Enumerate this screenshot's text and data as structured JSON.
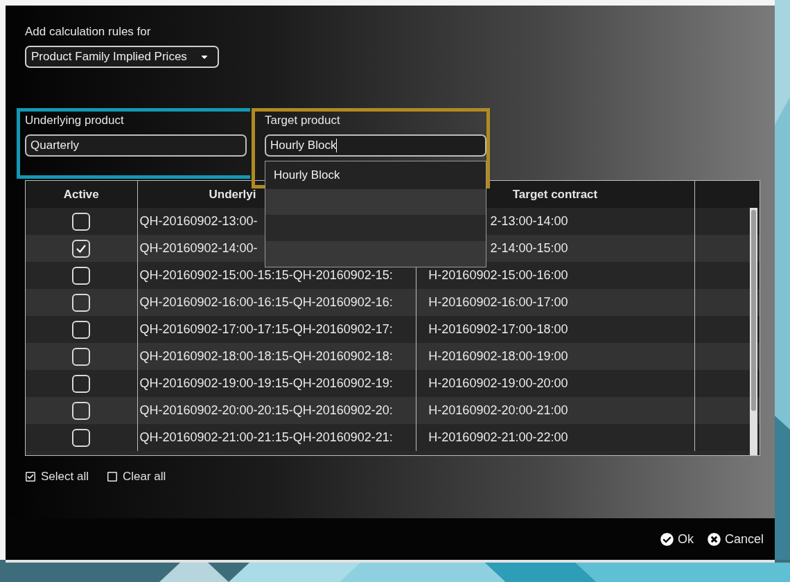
{
  "heading": "Add calculation rules for",
  "rule_type": {
    "value": "Product Family Implied Prices"
  },
  "fields": [
    {
      "label": "Underlying product",
      "value": "Quarterly"
    },
    {
      "label": "Target product",
      "value": "Hourly Block",
      "suggestions": [
        "Hourly Block"
      ]
    }
  ],
  "table": {
    "columns": [
      "Active",
      "Underlyi",
      "Target contract"
    ],
    "rows": [
      {
        "active": false,
        "underlying": "QH-20160902-13:00-",
        "target": "2-13:00-14:00"
      },
      {
        "active": true,
        "underlying": "QH-20160902-14:00-",
        "target": "2-14:00-15:00"
      },
      {
        "active": false,
        "underlying": "QH-20160902-15:00-15:15-QH-20160902-15:",
        "target": "H-20160902-15:00-16:00"
      },
      {
        "active": false,
        "underlying": "QH-20160902-16:00-16:15-QH-20160902-16:",
        "target": "H-20160902-16:00-17:00"
      },
      {
        "active": false,
        "underlying": "QH-20160902-17:00-17:15-QH-20160902-17:",
        "target": "H-20160902-17:00-18:00"
      },
      {
        "active": false,
        "underlying": "QH-20160902-18:00-18:15-QH-20160902-18:",
        "target": "H-20160902-18:00-19:00"
      },
      {
        "active": false,
        "underlying": "QH-20160902-19:00-19:15-QH-20160902-19:",
        "target": "H-20160902-19:00-20:00"
      },
      {
        "active": false,
        "underlying": "QH-20160902-20:00-20:15-QH-20160902-20:",
        "target": "H-20160902-20:00-21:00"
      },
      {
        "active": false,
        "underlying": "QH-20160902-21:00-21:15-QH-20160902-21:",
        "target": "H-20160902-21:00-22:00"
      }
    ]
  },
  "actions": [
    {
      "kind": "select",
      "label": "Select all"
    },
    {
      "kind": "clear",
      "label": "Clear all"
    }
  ],
  "buttons": [
    {
      "kind": "ok",
      "label": "Ok"
    },
    {
      "kind": "cancel",
      "label": "Cancel"
    }
  ]
}
